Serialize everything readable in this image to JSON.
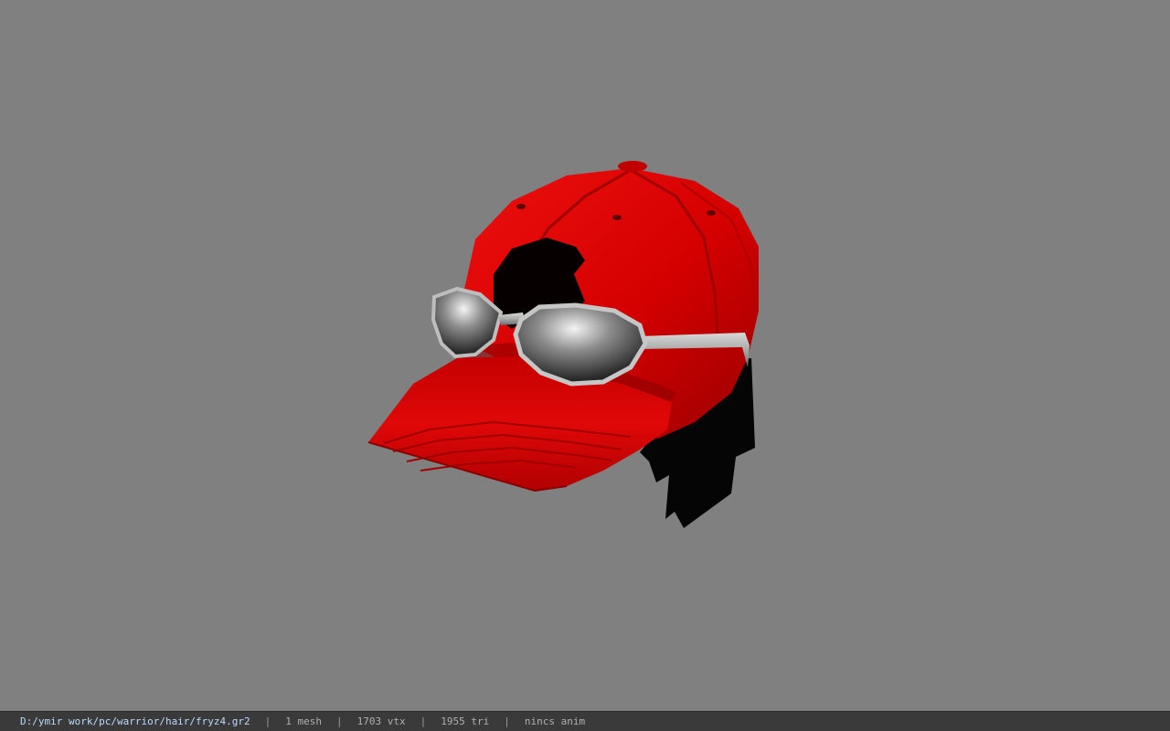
{
  "status_bar": {
    "file_path": "D:/ymir work/pc/warrior/hair/fryz4.gr2",
    "separator": "|",
    "mesh_count": "1 mesh",
    "vertex_count": "1703 vtx",
    "triangle_count": "1955 tri",
    "anim_status": "nincs anim"
  },
  "colors": {
    "viewport_background": "#808080",
    "cap_red": "#d40000",
    "hair_black": "#050505",
    "glasses_frame": "#a8aaa8",
    "status_background": "#3a3a3a",
    "path_text": "#b9dcff"
  }
}
